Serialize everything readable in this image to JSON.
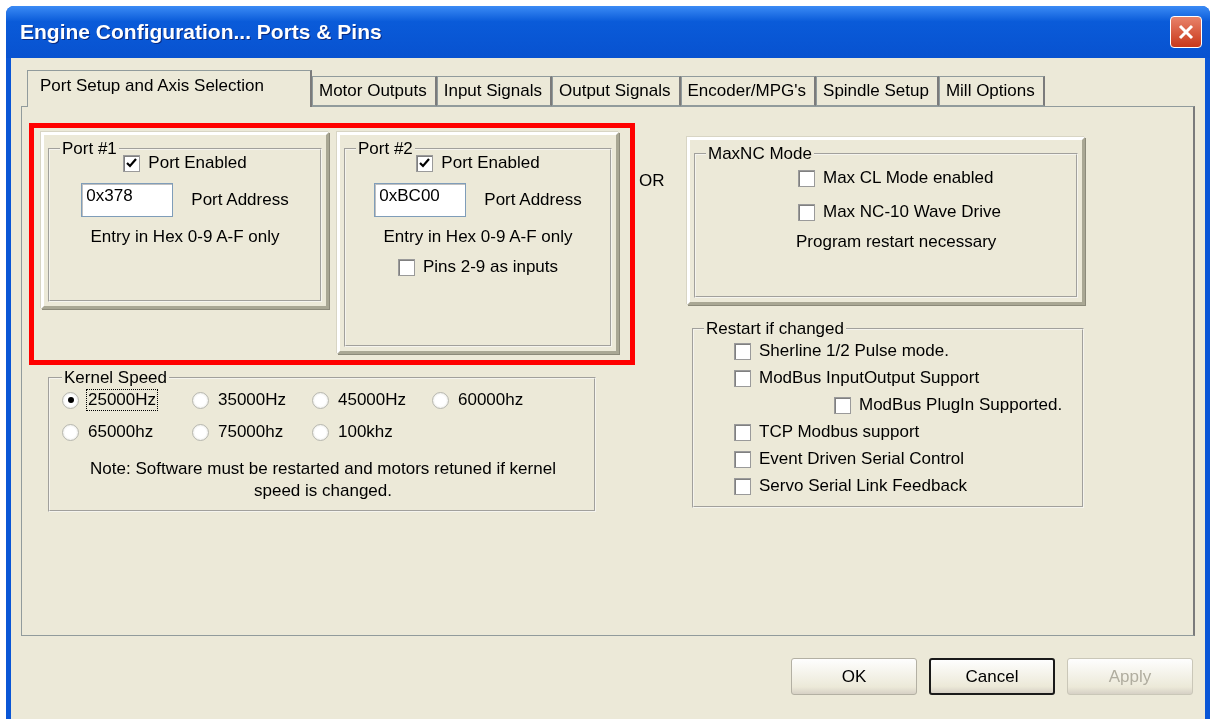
{
  "window": {
    "title": "Engine Configuration... Ports & Pins"
  },
  "tabs": [
    {
      "label": "Port Setup and Axis Selection",
      "selected": true
    },
    {
      "label": "Motor Outputs",
      "selected": false
    },
    {
      "label": "Input Signals",
      "selected": false
    },
    {
      "label": "Output Signals",
      "selected": false
    },
    {
      "label": "Encoder/MPG's",
      "selected": false
    },
    {
      "label": "Spindle Setup",
      "selected": false
    },
    {
      "label": "Mill Options",
      "selected": false
    }
  ],
  "ports": [
    {
      "title": "Port #1",
      "enabled": {
        "label": "Port Enabled",
        "checked": true
      },
      "address": {
        "value": "0x378",
        "label": "Port Address"
      },
      "hint": "Entry in Hex 0-9 A-F only"
    },
    {
      "title": "Port #2",
      "enabled": {
        "label": "Port Enabled",
        "checked": true
      },
      "address": {
        "value": "0xBC00",
        "label": "Port Address"
      },
      "hint": "Entry in Hex 0-9 A-F only",
      "pins_as_inputs": {
        "label": "Pins 2-9 as inputs",
        "checked": false
      }
    }
  ],
  "label_fragment": "OR",
  "kernel_speed": {
    "title": "Kernel Speed",
    "options": [
      {
        "label": "25000Hz",
        "selected": true,
        "focused": true
      },
      {
        "label": "35000Hz",
        "selected": false,
        "focused": false
      },
      {
        "label": "45000Hz",
        "selected": false,
        "focused": false
      },
      {
        "label": "60000hz",
        "selected": false,
        "focused": false
      },
      {
        "label": "65000hz",
        "selected": false,
        "focused": false
      },
      {
        "label": "75000hz",
        "selected": false,
        "focused": false
      },
      {
        "label": "100khz",
        "selected": false,
        "focused": false
      }
    ],
    "note": "Note: Software must be restarted and motors retuned if kernel speed is changed."
  },
  "maxnc": {
    "title": "MaxNC Mode",
    "options": [
      {
        "label": "Max CL Mode enabled",
        "checked": false
      },
      {
        "label": "Max NC-10 Wave Drive",
        "checked": false
      }
    ],
    "note": "Program restart necessary"
  },
  "restart": {
    "title": "Restart if changed",
    "options": [
      {
        "label": "Sherline 1/2 Pulse mode.",
        "checked": false
      },
      {
        "label": "ModBus InputOutput Support",
        "checked": false,
        "children": [
          {
            "label": "ModBus PlugIn Supported.",
            "checked": false
          }
        ]
      },
      {
        "label": "TCP Modbus support",
        "checked": false
      },
      {
        "label": "Event Driven Serial Control",
        "checked": false
      },
      {
        "label": "Servo Serial Link Feedback",
        "checked": false
      }
    ]
  },
  "buttons": [
    {
      "label": "OK",
      "default": false,
      "disabled": false
    },
    {
      "label": "Cancel",
      "default": true,
      "disabled": false
    },
    {
      "label": "Apply",
      "default": false,
      "disabled": true
    }
  ]
}
